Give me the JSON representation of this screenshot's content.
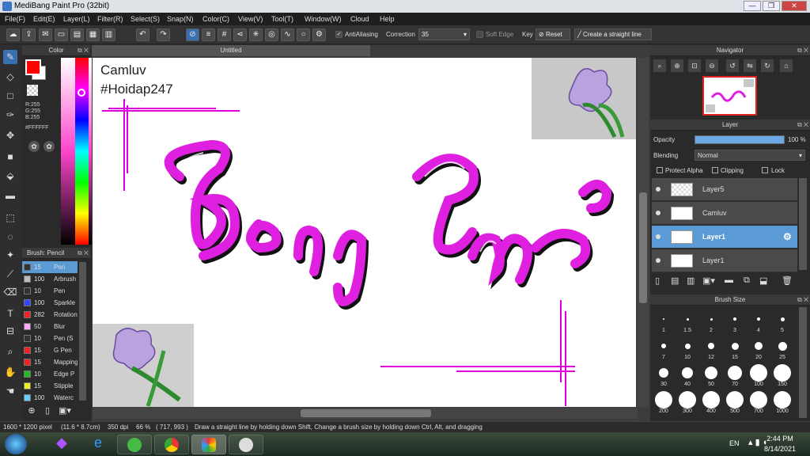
{
  "title": "MediBang Paint Pro (32bit)",
  "menu": [
    "File(F)",
    "Edit(E)",
    "Layer(L)",
    "Filter(R)",
    "Select(S)",
    "Snap(N)",
    "Color(C)",
    "View(V)",
    "Tool(T)",
    "Window(W)",
    "Cloud",
    "Help"
  ],
  "toolbar": {
    "antialiasing": "AntiAliasing",
    "correction_label": "Correction",
    "correction_value": "35",
    "soft_edge": "Soft Edge",
    "key_label": "Key",
    "reset": "Reset",
    "straight_line": "Create a straight line"
  },
  "color_panel": {
    "title": "Color",
    "r": "R:255",
    "g": "G:255",
    "b": "B:255",
    "hex": "#FFFFFF",
    "primary": "#ff0000",
    "secondary": "#ffffff"
  },
  "brush_panel": {
    "title": "Brush: Pencil",
    "items": [
      {
        "size": "15",
        "name": "Pen",
        "color": "#333333"
      },
      {
        "size": "100",
        "name": "Arbrush",
        "color": "#bbbbbb"
      },
      {
        "size": "10",
        "name": "Pen",
        "color": "#333333"
      },
      {
        "size": "100",
        "name": "Sparkle",
        "color": "#3344ff"
      },
      {
        "size": "282",
        "name": "Rotation",
        "color": "#ee2222"
      },
      {
        "size": "50",
        "name": "Blur",
        "color": "#ffaaff"
      },
      {
        "size": "10",
        "name": "Pen (S",
        "color": "#333333"
      },
      {
        "size": "15",
        "name": "G Pen",
        "color": "#ee2222"
      },
      {
        "size": "15",
        "name": "Mapping",
        "color": "#ee2222"
      },
      {
        "size": "10",
        "name": "Edge P",
        "color": "#22bb22"
      },
      {
        "size": "15",
        "name": "Stipple",
        "color": "#eeee22"
      },
      {
        "size": "100",
        "name": "Waterc",
        "color": "#66ccff"
      }
    ]
  },
  "canvas": {
    "tab": "Untitled",
    "text1": "Camluv",
    "text2": "#Hoidap247",
    "lettering": "Bồng Lan"
  },
  "navigator": {
    "title": "Navigator"
  },
  "layer_panel": {
    "title": "Layer",
    "opacity_label": "Opacity",
    "opacity_value": "100 %",
    "opacity_pct": 100,
    "blending_label": "Blending",
    "blending_value": "Normal",
    "protect_alpha": "Protect Alpha",
    "clipping": "Clipping",
    "lock": "Lock",
    "layers": [
      "Layer5",
      "Camluv",
      "Layer1",
      "Layer1"
    ]
  },
  "brush_size": {
    "title": "Brush Size",
    "sizes": [
      "1",
      "1.5",
      "2",
      "3",
      "4",
      "5",
      "7",
      "10",
      "12",
      "15",
      "20",
      "25",
      "30",
      "40",
      "50",
      "70",
      "100",
      "150",
      "200",
      "300",
      "400",
      "500",
      "700",
      "1000"
    ]
  },
  "status": {
    "dims": "1600 * 1200 pixel",
    "cm": "(11.6 * 8.7cm)",
    "dpi": "350 dpi",
    "zoom": "66 %",
    "coords": "( 717, 993 )",
    "hint": "Draw a straight line by holding down Shift, Change a brush size by holding down Ctrl, Alt, and dragging"
  },
  "taskbar": {
    "lang": "EN",
    "time": "2:44 PM",
    "date": "8/14/2021"
  }
}
